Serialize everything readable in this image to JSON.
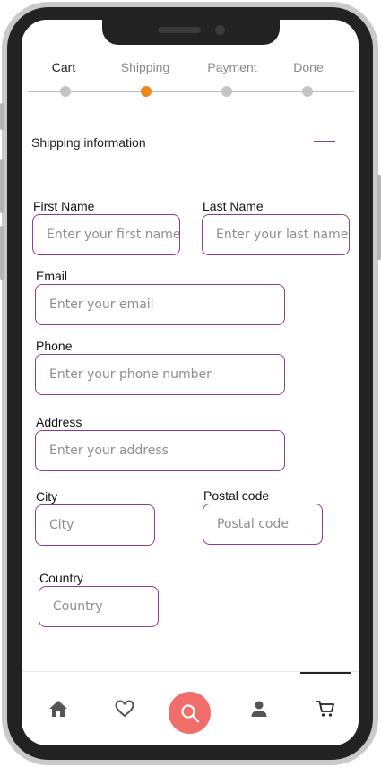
{
  "stepper": {
    "steps": [
      {
        "label": "Cart"
      },
      {
        "label": "Shipping"
      },
      {
        "label": "Payment"
      },
      {
        "label": "Done"
      }
    ],
    "current_step": "Shipping",
    "accent_color": "#f0871a"
  },
  "section": {
    "title": "Shipping information",
    "toggle_icon": "collapse-icon"
  },
  "form": {
    "first_name": {
      "label": "First Name",
      "placeholder": "Enter your first name"
    },
    "last_name": {
      "label": "Last Name",
      "placeholder": "Enter your last name"
    },
    "email": {
      "label": "Email",
      "placeholder": "Enter your email"
    },
    "phone": {
      "label": "Phone",
      "placeholder": "Enter your phone number"
    },
    "address": {
      "label": "Address",
      "placeholder": "Enter your address"
    },
    "city": {
      "label": "City",
      "placeholder": "City"
    },
    "postal_code": {
      "label": "Postal code",
      "placeholder": "Postal code"
    },
    "country": {
      "label": "Country",
      "placeholder": "Country"
    },
    "border_color": "#8e3a8e"
  },
  "bottom_nav": {
    "items": [
      "home-icon",
      "heart-icon",
      "search-icon",
      "person-icon",
      "cart-icon"
    ],
    "active": "cart-icon",
    "fab_color": "#f06e6a"
  }
}
